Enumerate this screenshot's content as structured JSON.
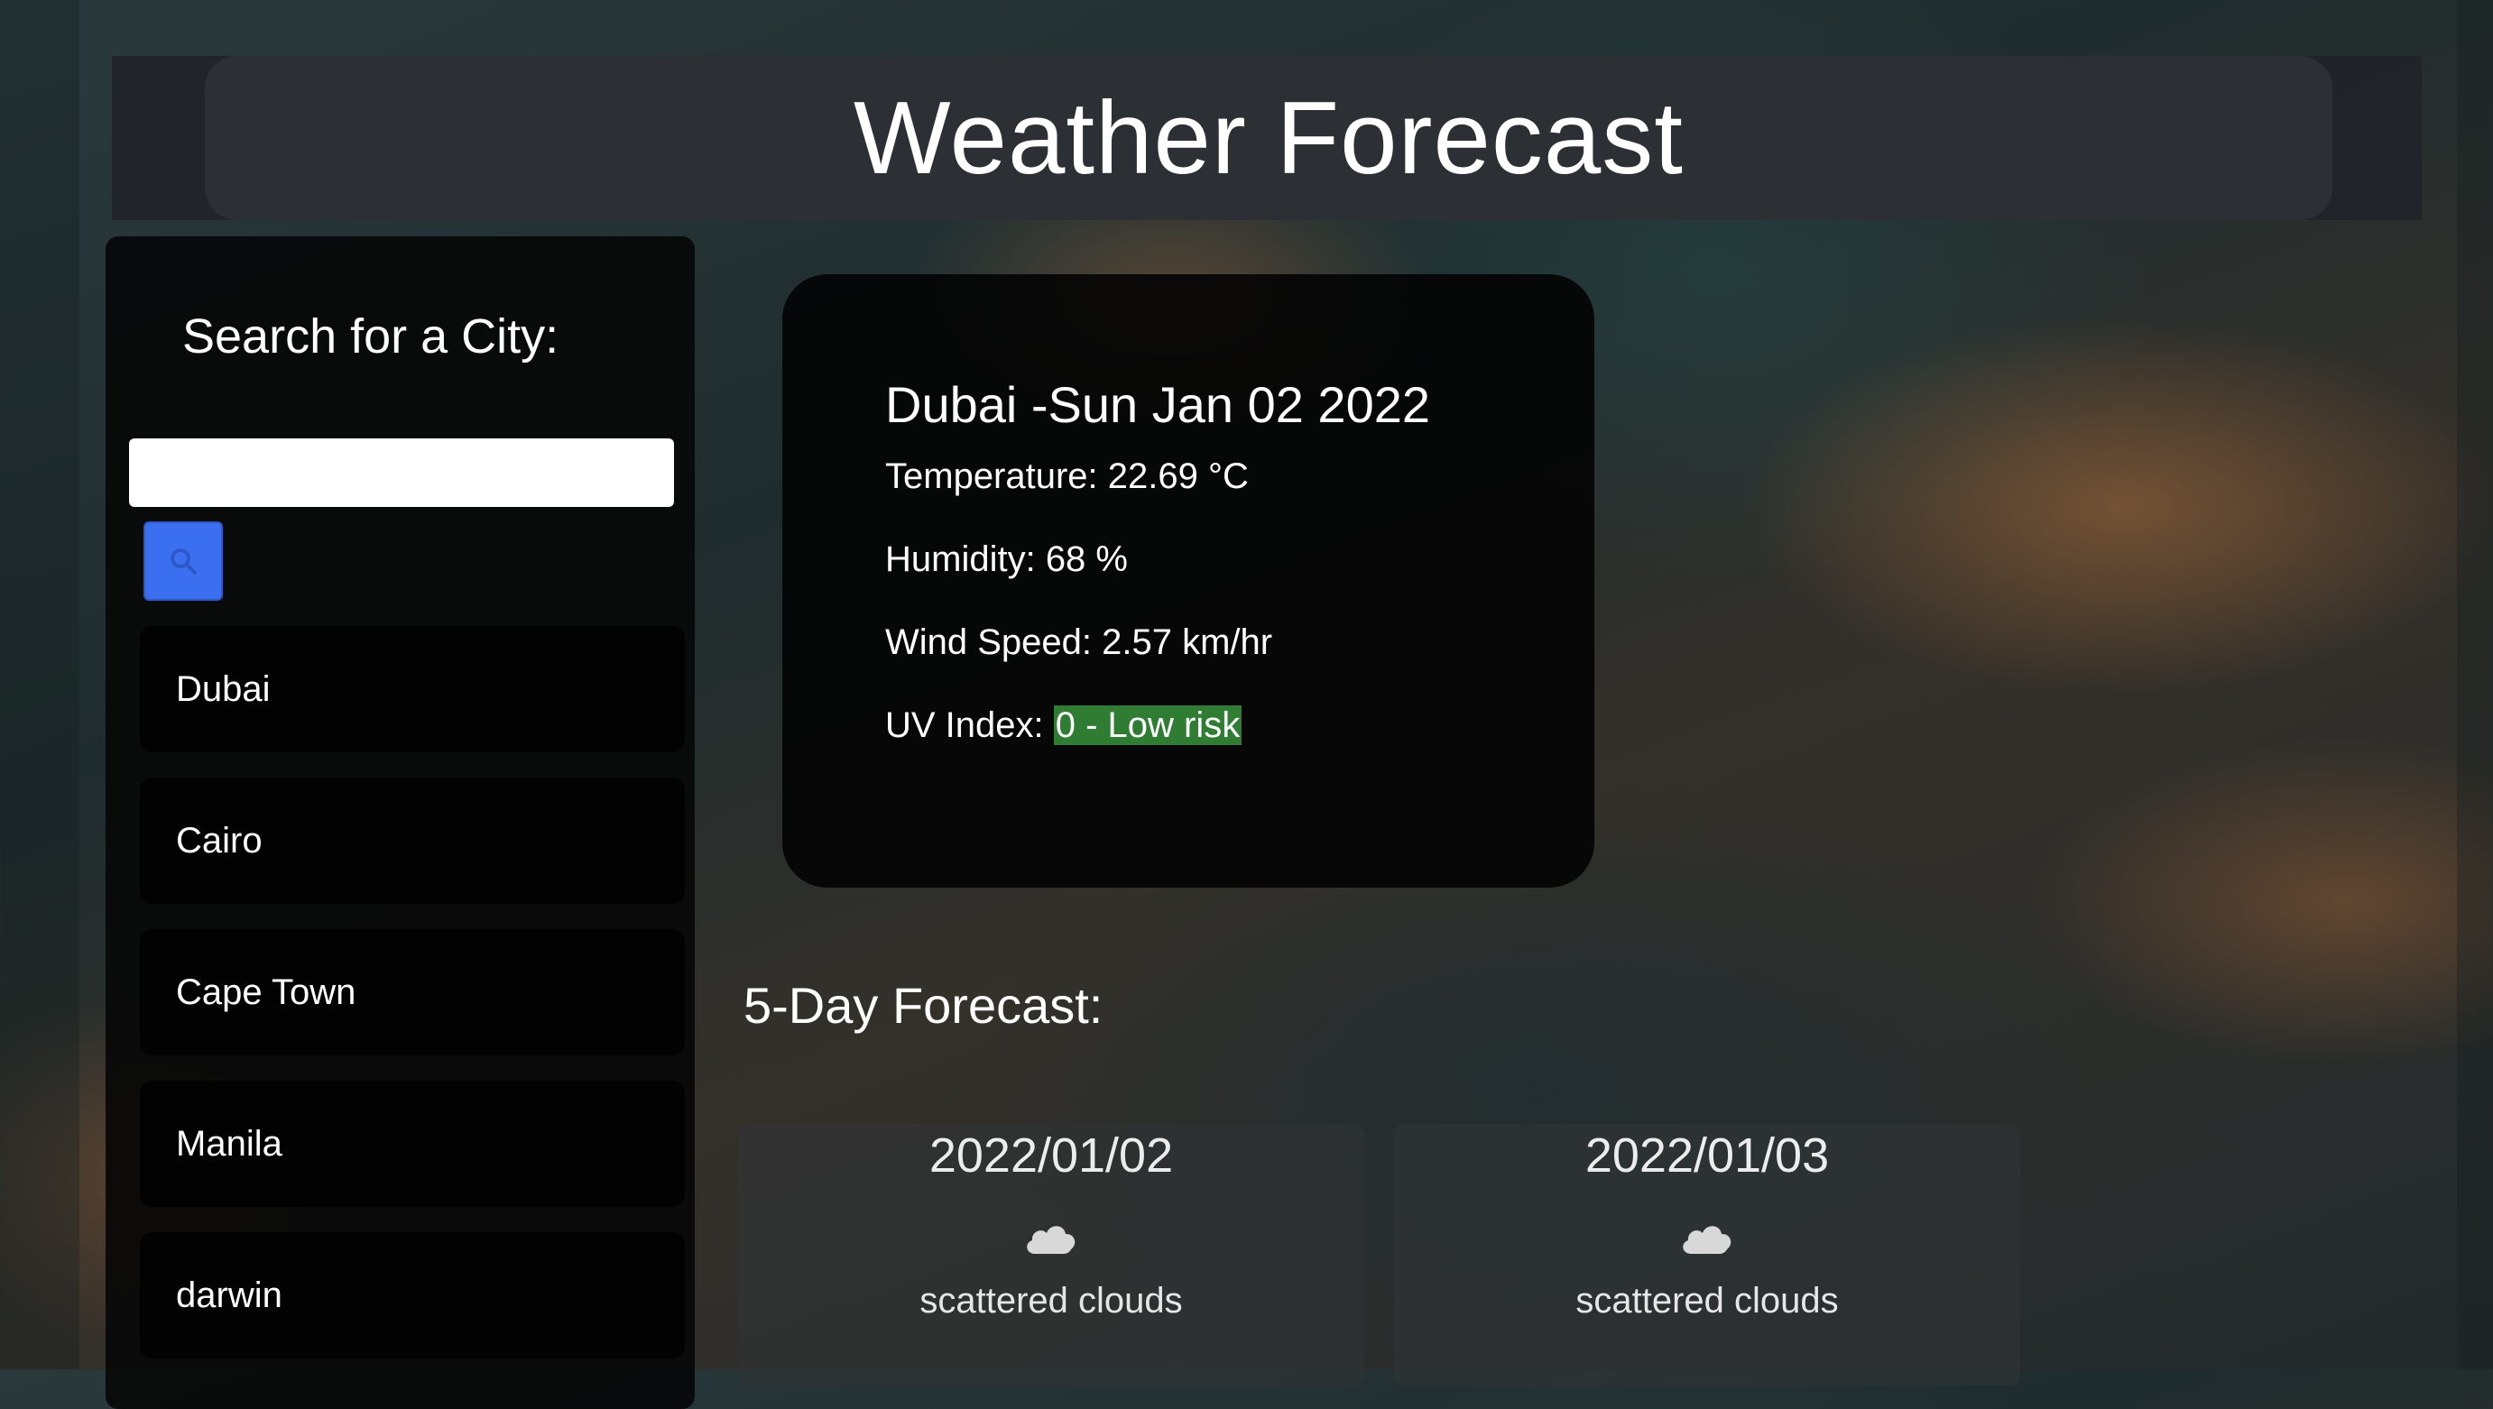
{
  "header": {
    "title": "Weather Forecast"
  },
  "sidebar": {
    "search_label": "Search for a City:",
    "search_input_value": "",
    "search_input_placeholder": "",
    "search_button_icon": "search-icon",
    "cities": [
      "Dubai",
      "Cairo",
      "Cape Town",
      "Manila",
      "darwin"
    ]
  },
  "current": {
    "title": "Dubai -Sun Jan 02 2022",
    "temperature_label": "Temperature: 22.69 °C",
    "humidity_label": "Humidity: 68 %",
    "wind_label": "Wind Speed: 2.57 km/hr",
    "uv_label": "UV Index: ",
    "uv_value": "0 - Low risk",
    "uv_color": "#2e7d32"
  },
  "forecast": {
    "heading": "5-Day Forecast:",
    "days": [
      {
        "date": "2022/01/02",
        "icon": "cloud-icon",
        "description": "scattered clouds"
      },
      {
        "date": "2022/01/03",
        "icon": "cloud-icon",
        "description": "scattered clouds"
      }
    ]
  },
  "colors": {
    "accent_button": "#3a6ff0",
    "card_bg": "#030303",
    "header_bg": "#2c2f34"
  }
}
